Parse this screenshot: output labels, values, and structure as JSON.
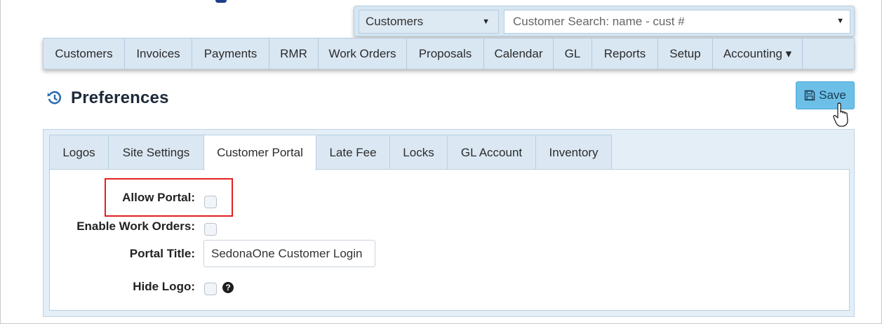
{
  "search_bar": {
    "type_select_value": "Customers",
    "search_placeholder": "Customer Search: name - cust #"
  },
  "nav": {
    "items": [
      {
        "label": "Customers"
      },
      {
        "label": "Invoices"
      },
      {
        "label": "Payments"
      },
      {
        "label": "RMR"
      },
      {
        "label": "Work Orders"
      },
      {
        "label": "Proposals"
      },
      {
        "label": "Calendar"
      },
      {
        "label": "GL"
      },
      {
        "label": "Reports"
      },
      {
        "label": "Setup"
      },
      {
        "label": "Accounting ▾"
      }
    ]
  },
  "header": {
    "title": "Preferences",
    "save_label": "Save"
  },
  "tabs": [
    {
      "label": "Logos"
    },
    {
      "label": "Site Settings"
    },
    {
      "label": "Customer Portal"
    },
    {
      "label": "Late Fee"
    },
    {
      "label": "Locks"
    },
    {
      "label": "GL Account"
    },
    {
      "label": "Inventory"
    }
  ],
  "active_tab": "Customer Portal",
  "form": {
    "allow_portal_label": "Allow Portal:",
    "allow_portal_checked": false,
    "enable_work_orders_label": "Enable Work Orders:",
    "enable_work_orders_checked": false,
    "portal_title_label": "Portal Title:",
    "portal_title_value": "SedonaOne Customer Login",
    "hide_logo_label": "Hide Logo:",
    "hide_logo_checked": false,
    "help_glyph": "?"
  },
  "colors": {
    "save_button": "#6cc0e8",
    "highlight": "#e32020",
    "nav_background": "#d9e7f3"
  }
}
